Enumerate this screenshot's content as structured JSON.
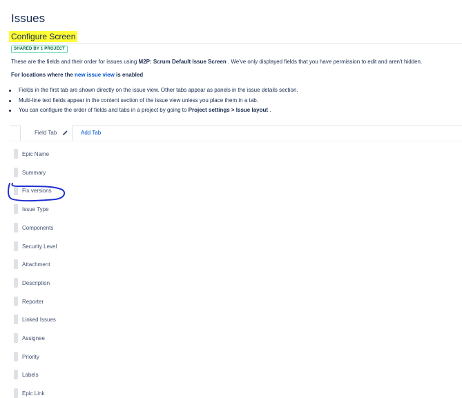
{
  "page": {
    "title": "Issues"
  },
  "screen": {
    "title": "Configure Screen",
    "badge": "SHARED BY 1 PROJECT",
    "description_prefix": "These are the fields and their order for issues using ",
    "screen_name": "M2P: Scrum Default Issue Screen",
    "description_suffix": " . We've only displayed fields that you have permission to edit and aren't hidden.",
    "locations_prefix": "For locations where the ",
    "locations_link": "new issue view",
    "locations_suffix": " is enabled"
  },
  "bullets": {
    "first": "Fields in the first tab are shown directly on the issue view. Other tabs appear as panels in the issue details section.",
    "second": "Multi-line text fields appear in the content section of the issue view unless you place them in a tab.",
    "third_prefix": "You can configure the order of fields and tabs in a project by going to ",
    "third_bold": "Project settings > Issue layout",
    "third_suffix": " ."
  },
  "tabs": {
    "field_tab": "Field Tab",
    "add_tab": "Add Tab"
  },
  "fields": [
    "Epic Name",
    "Summary",
    "Fix versions",
    "Issue Type",
    "Components",
    "Security Level",
    "Attachment",
    "Description",
    "Reporter",
    "Linked Issues",
    "Assignee",
    "Priority",
    "Labels",
    "Epic Link"
  ],
  "colors": {
    "highlight": "#fffd38",
    "link": "#0052cc",
    "badge_border": "#57d9a3",
    "annotation": "#1f2ed1"
  },
  "icons": {
    "edit": "pencil-icon",
    "drag": "drag-handle"
  }
}
